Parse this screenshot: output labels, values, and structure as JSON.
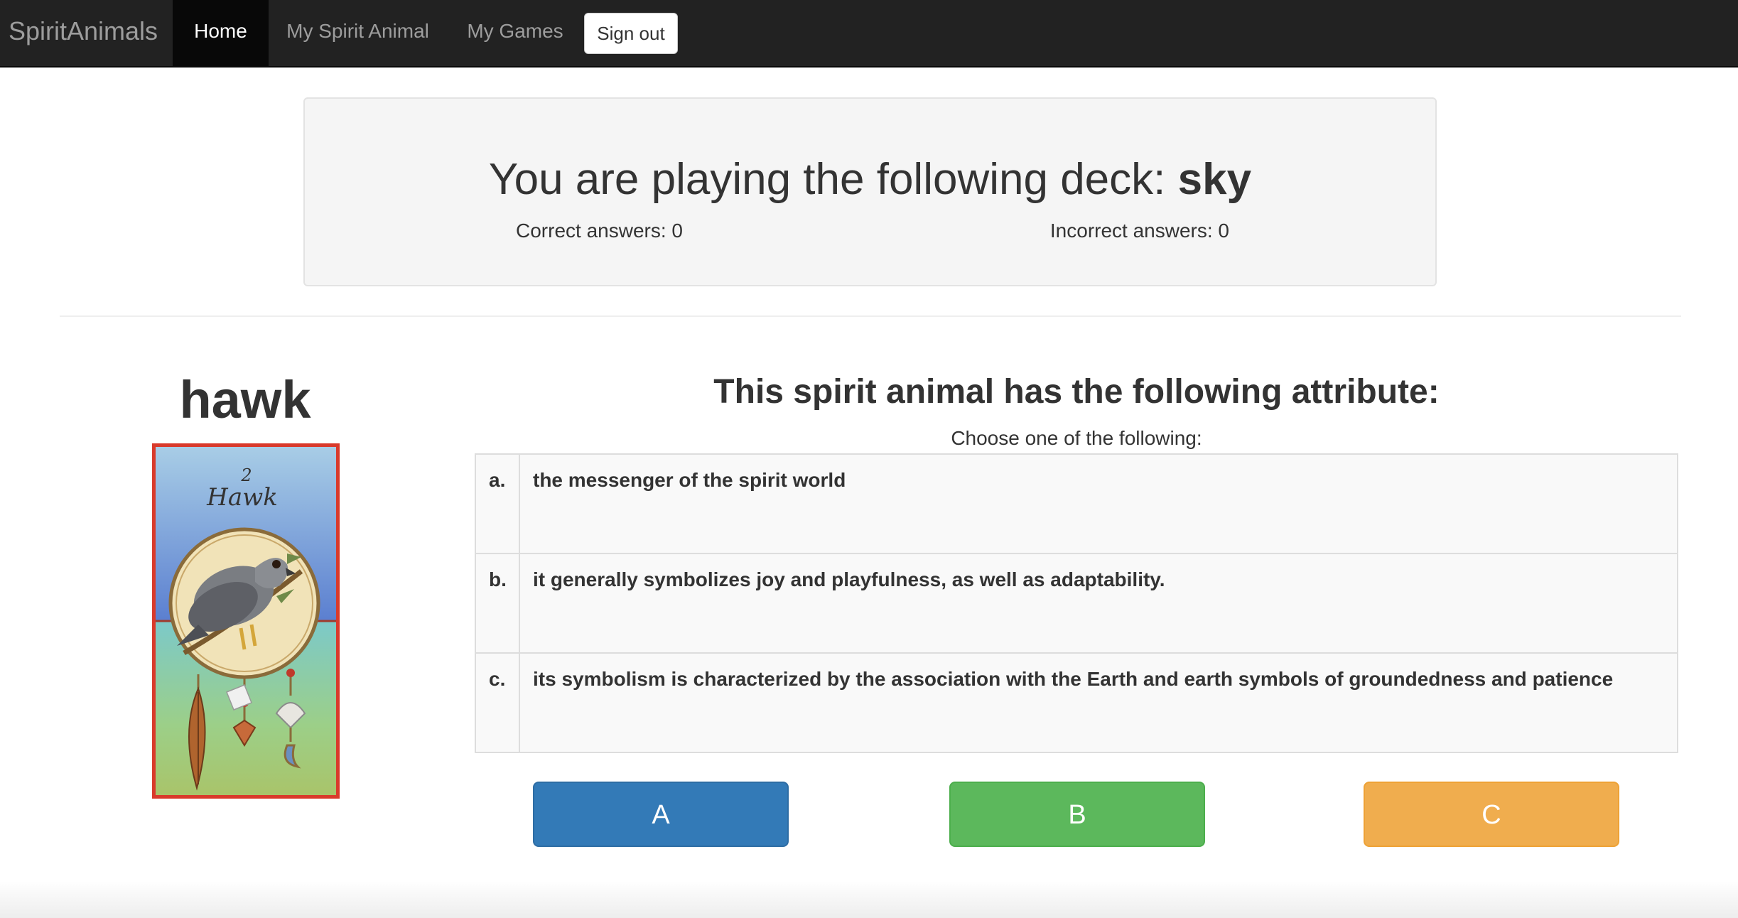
{
  "navbar": {
    "brand": "SpiritAnimals",
    "items": [
      {
        "label": "Home",
        "active": true
      },
      {
        "label": "My Spirit Animal",
        "active": false
      },
      {
        "label": "My Games",
        "active": false
      }
    ],
    "signout_label": "Sign out"
  },
  "game": {
    "deck_prefix": "You are playing the following deck: ",
    "deck_name": "sky",
    "correct_label": "Correct answers: 0",
    "incorrect_label": "Incorrect answers: 0"
  },
  "card": {
    "animal_name": "hawk",
    "card_number": "2",
    "card_title": "Hawk"
  },
  "question": {
    "title": "This spirit animal has the following attribute:",
    "instruction": "Choose one of the following:",
    "options": [
      {
        "letter": "a.",
        "text": "the messenger of the spirit world"
      },
      {
        "letter": "b.",
        "text": "it generally symbolizes joy and playfulness, as well as adaptability."
      },
      {
        "letter": "c.",
        "text": "its symbolism is characterized by the association with the Earth and earth symbols of groundedness and patience"
      }
    ]
  },
  "answer_buttons": [
    {
      "label": "A",
      "color": "#337ab7"
    },
    {
      "label": "B",
      "color": "#5cb85c"
    },
    {
      "label": "C",
      "color": "#f0ad4e"
    }
  ],
  "colors": {
    "navbar_bg": "#222222",
    "card_border": "#d93a2b"
  }
}
